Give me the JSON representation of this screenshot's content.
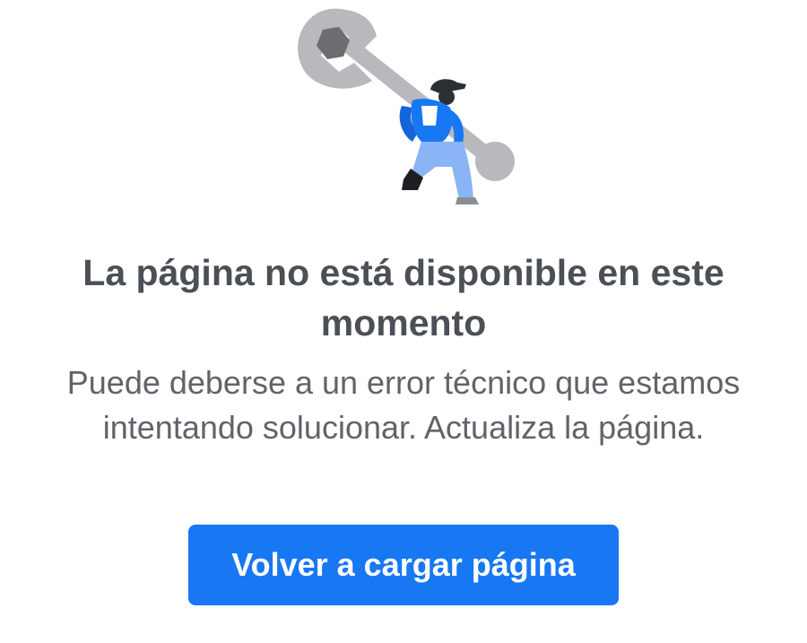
{
  "illustration": {
    "icon": "mechanic-with-wrench",
    "colors": {
      "wrench": "#b7b9bd",
      "nut": "#6b6d70",
      "shirt": "#1877f2",
      "pants": "#8ab4f5",
      "boot": "#1c1e21",
      "cap": "#2c2f33"
    }
  },
  "error": {
    "title": "La página no está disponible en este momento",
    "description": "Puede deberse a un error técnico que estamos intentando solucionar. Actualiza la página."
  },
  "actions": {
    "reload_label": "Volver a cargar página"
  },
  "colors": {
    "accent": "#1877f2",
    "title_text": "#4b4f56",
    "body_text": "#60646a",
    "background": "#ffffff"
  }
}
